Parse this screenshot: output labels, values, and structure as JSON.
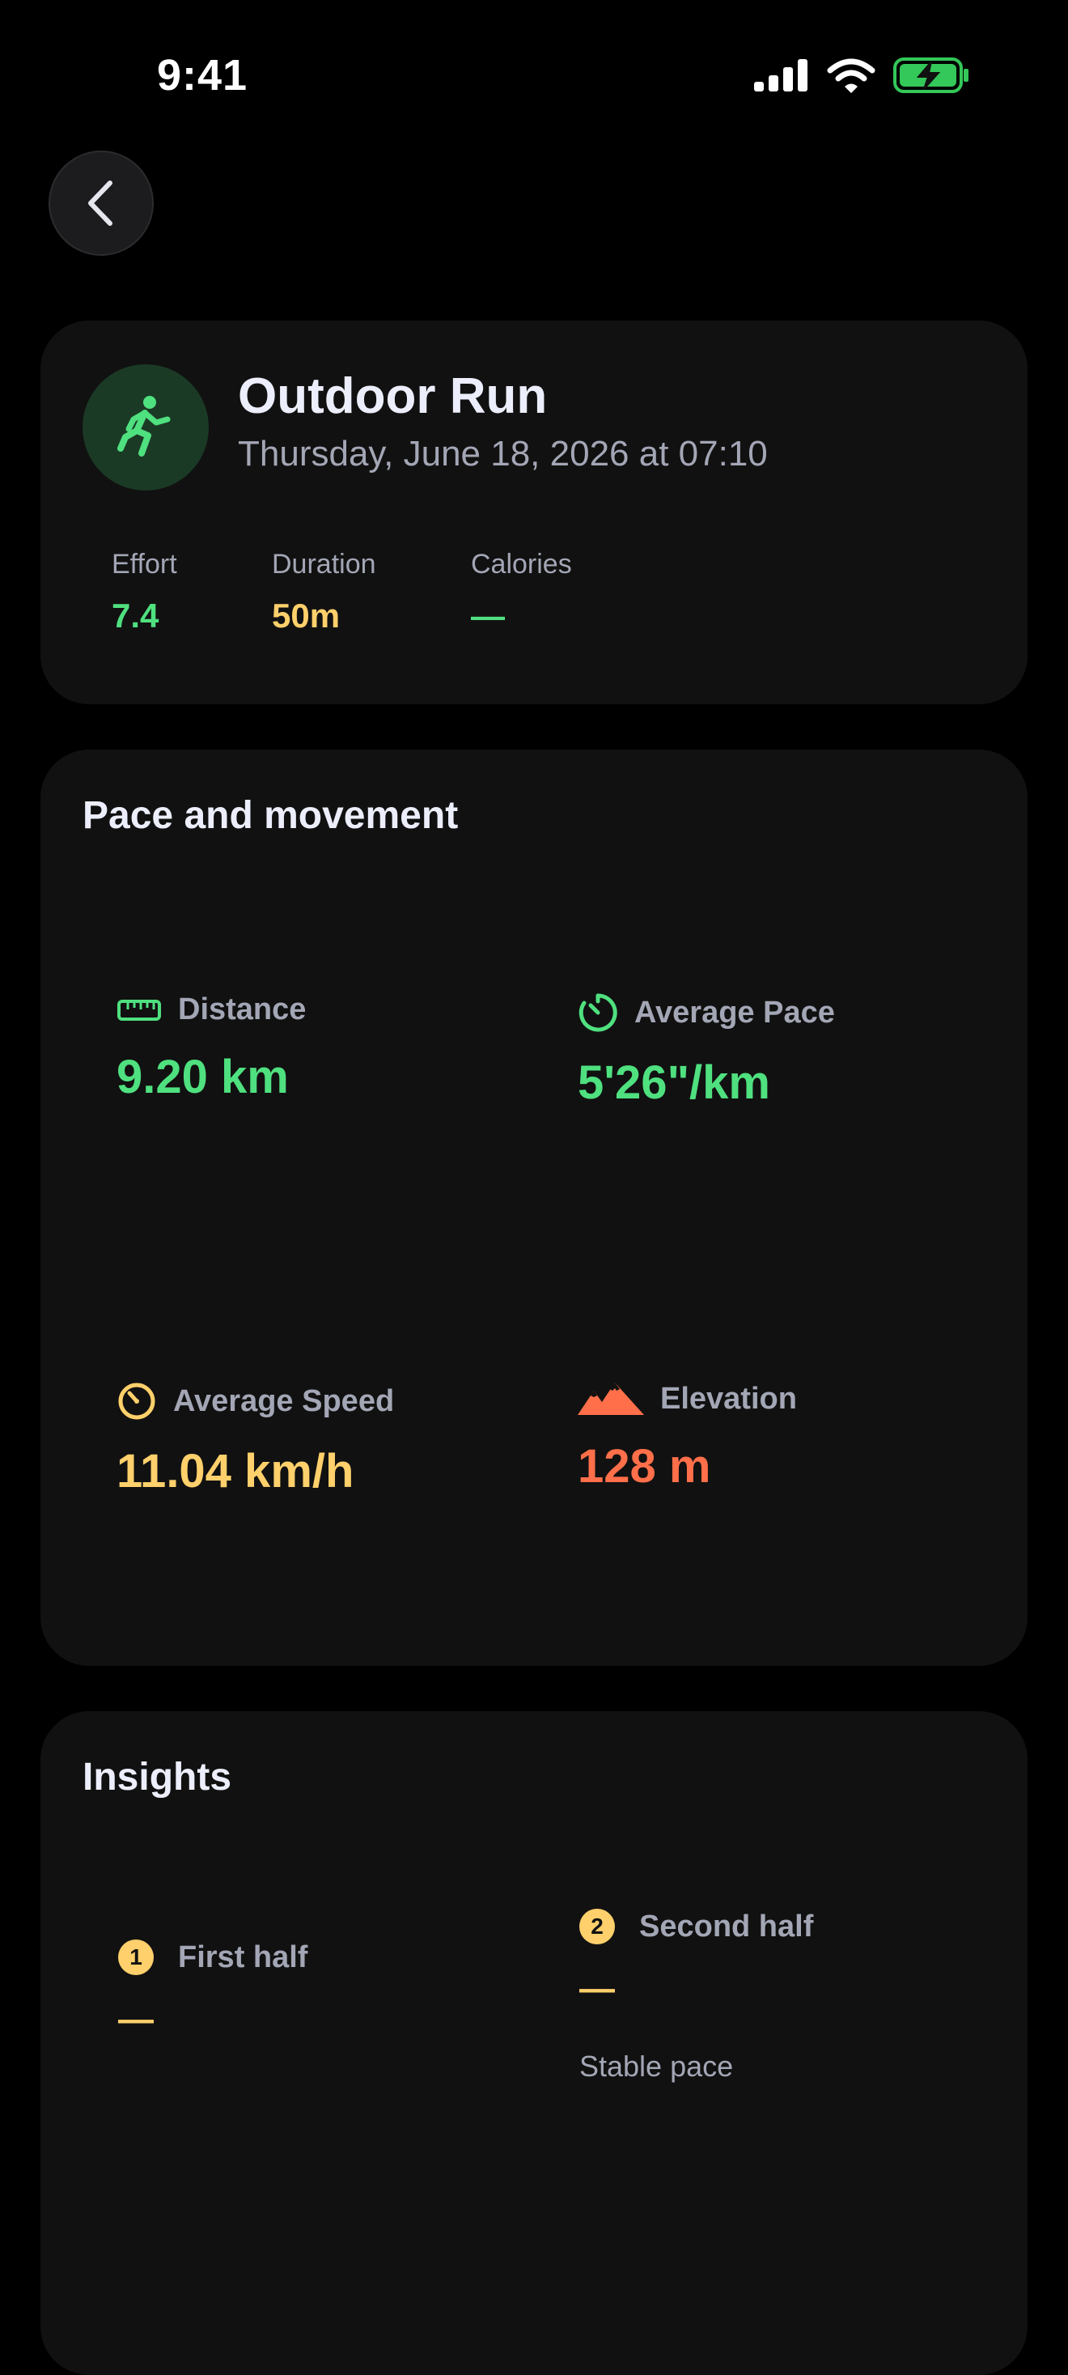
{
  "status_bar": {
    "time": "9:41",
    "icons": [
      "cellular-signal-icon",
      "wifi-icon",
      "battery-charging-icon"
    ],
    "battery_color": "#34c759"
  },
  "nav": {
    "back_icon": "chevron-left-icon"
  },
  "workout": {
    "icon": "running-figure-icon",
    "title": "Outdoor Run",
    "date": "Thursday, June 18, 2026 at 07:10",
    "stats": [
      {
        "label": "Effort",
        "value": "7.4",
        "color": "#4fe07f"
      },
      {
        "label": "Duration",
        "value": "50m",
        "color": "#ffd06b"
      },
      {
        "label": "Calories",
        "value": "—",
        "color": "#4fe07f"
      }
    ]
  },
  "pace": {
    "title": "Pace and movement",
    "metrics": [
      {
        "icon": "ruler-icon",
        "label": "Distance",
        "value": "9.20 km",
        "color": "#4fe07f"
      },
      {
        "icon": "timer-icon",
        "label": "Average Pace",
        "value": "5'26\"/km",
        "color": "#4fe07f"
      },
      {
        "icon": "speedometer-icon",
        "label": "Average Speed",
        "value": "11.04 km/h",
        "color": "#ffd06b"
      },
      {
        "icon": "mountains-icon",
        "label": "Elevation",
        "value": "128 m",
        "color": "#ff6f4a"
      }
    ]
  },
  "insights": {
    "title": "Insights",
    "items": [
      {
        "badge": "1",
        "label": "First half",
        "value": "—",
        "note": ""
      },
      {
        "badge": "2",
        "label": "Second half",
        "value": "—",
        "note": "Stable pace"
      }
    ]
  },
  "colors": {
    "accent_green": "#4fe07f",
    "accent_yellow": "#ffd06b",
    "accent_orange": "#ff6f4a",
    "card_bg": "#111111"
  }
}
